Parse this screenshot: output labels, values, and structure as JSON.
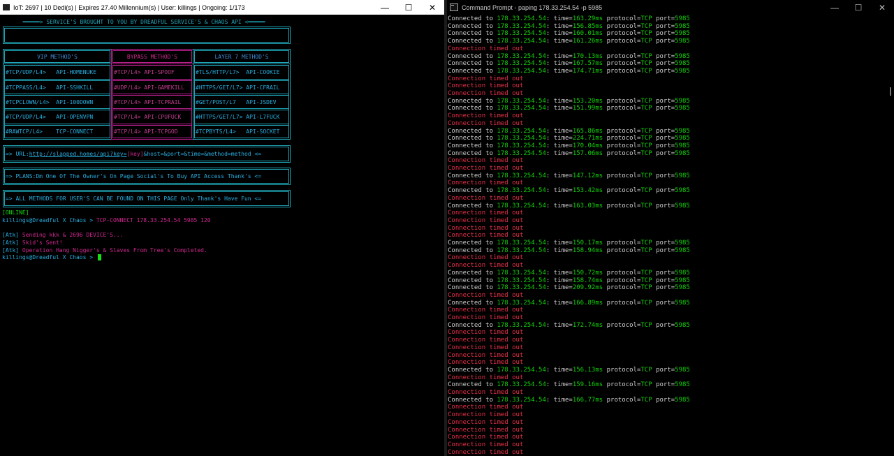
{
  "left_window": {
    "title": "IoT: 2697 | 10 Dedi(s) | Expires 27.40 Millennium(s) | User: killings | Ongoing: 1/173",
    "controls": {
      "minimize": "—",
      "maximize": "☐",
      "close": "✕"
    },
    "banner": "═════> SERVICE'S BROUGHT TO YOU BY DREADFUL SERVICE'S & CHAOS API <═════",
    "headers": [
      "VIP METHOD'S",
      "BYPASS METHOD'S",
      "LAYER 7 METHOD'S"
    ],
    "col1": [
      "#TCP/UDP/L4>   API-HOMENUKE",
      "#TCPPASS/L4>   API-SSHKILL",
      "#TCPCLOWN/L4>  API-100DOWN",
      "#TCP/UDP/L4>   API-OPENVPN",
      "#RAWTCP/L4>    TCP-CONNECT"
    ],
    "col2": [
      "#TCP/L4> API-SPOOF",
      "#UDP/L4> API-GAMEKILL",
      "#TCP/L4> API-TCPRAIL",
      "#TCP/L4> API-CPUFUCK",
      "#TCP/L4> API-TCPGOD"
    ],
    "col3": [
      "#TLS/HTTP/L7>  API-COOKIE",
      "#HTTPS/GET/L7> API-CFRAIL",
      "#GET/POST/L7   API-JSDEV",
      "#HTTPS/GET/L7> API-L7FUCK",
      "#TCPBYTS/L4>   API-SOCKET"
    ],
    "url_prefix": "=> URL:",
    "url_link": "http://slapped.homes/api?key=",
    "url_key": "[key]",
    "url_rest": "&host=&port=&time=&method=method <=",
    "plans": "=> PLANS:Dm One Of The Owner's On Page Social's To Buy API Access Thank's <=",
    "all_methods": "=> ALL METHODS FOR USER'S CAN BE FOUND ON THIS PAGE Only Thank's Have Fun <=",
    "status": "[ONLINE]",
    "prompt": "killings@Dreadful X Chaos > ",
    "command": "TCP-CONNECT 178.33.254.54 5985 120",
    "atk_tag": "[Atk]",
    "atk1": " Sending kkk & 2696 DEVICE'S...",
    "atk2": " Skid's Sent!",
    "atk3": " Operation Hang Nigger's & Slaves From Tree's Completed."
  },
  "right_window": {
    "title": "Command Prompt - paping  178.33.254.54 -p 5985",
    "controls": {
      "minimize": "—",
      "maximize": "☐",
      "close": "✕"
    },
    "conn_prefix": "Connected to ",
    "host": "178.33.254.54",
    "time_label": ": time=",
    "proto_label": " protocol=",
    "proto": "TCP",
    "port_label": " port=",
    "port": "5985",
    "timeout": "Connection timed out",
    "lines": [
      {
        "type": "ok",
        "time": "163.29ms"
      },
      {
        "type": "ok",
        "time": "156.85ms"
      },
      {
        "type": "ok",
        "time": "160.01ms"
      },
      {
        "type": "ok",
        "time": "161.26ms"
      },
      {
        "type": "to"
      },
      {
        "type": "ok",
        "time": "170.13ms"
      },
      {
        "type": "ok",
        "time": "167.57ms"
      },
      {
        "type": "ok",
        "time": "174.71ms"
      },
      {
        "type": "to"
      },
      {
        "type": "to"
      },
      {
        "type": "to"
      },
      {
        "type": "ok",
        "time": "153.20ms"
      },
      {
        "type": "ok",
        "time": "151.99ms"
      },
      {
        "type": "to"
      },
      {
        "type": "to"
      },
      {
        "type": "ok",
        "time": "165.86ms"
      },
      {
        "type": "ok",
        "time": "224.71ms"
      },
      {
        "type": "ok",
        "time": "170.04ms"
      },
      {
        "type": "ok",
        "time": "157.06ms"
      },
      {
        "type": "to"
      },
      {
        "type": "to"
      },
      {
        "type": "ok",
        "time": "147.12ms"
      },
      {
        "type": "to"
      },
      {
        "type": "ok",
        "time": "153.42ms"
      },
      {
        "type": "to"
      },
      {
        "type": "ok",
        "time": "163.03ms"
      },
      {
        "type": "to"
      },
      {
        "type": "to"
      },
      {
        "type": "to"
      },
      {
        "type": "to"
      },
      {
        "type": "ok",
        "time": "150.17ms"
      },
      {
        "type": "ok",
        "time": "158.94ms"
      },
      {
        "type": "to"
      },
      {
        "type": "to"
      },
      {
        "type": "ok",
        "time": "150.72ms"
      },
      {
        "type": "ok",
        "time": "158.74ms"
      },
      {
        "type": "ok",
        "time": "209.92ms"
      },
      {
        "type": "to"
      },
      {
        "type": "ok",
        "time": "166.89ms"
      },
      {
        "type": "to"
      },
      {
        "type": "to"
      },
      {
        "type": "ok",
        "time": "172.74ms"
      },
      {
        "type": "to"
      },
      {
        "type": "to"
      },
      {
        "type": "to"
      },
      {
        "type": "to"
      },
      {
        "type": "to"
      },
      {
        "type": "ok",
        "time": "156.13ms"
      },
      {
        "type": "to"
      },
      {
        "type": "ok",
        "time": "159.16ms"
      },
      {
        "type": "to"
      },
      {
        "type": "ok",
        "time": "166.77ms"
      },
      {
        "type": "to"
      },
      {
        "type": "to"
      },
      {
        "type": "to"
      },
      {
        "type": "to"
      },
      {
        "type": "to"
      },
      {
        "type": "to"
      },
      {
        "type": "to"
      }
    ]
  },
  "colors": {
    "cyan": "#1fa4b7",
    "magenta": "#b81f8d",
    "success_green": "#13d40a",
    "error_red": "#e8324a"
  }
}
